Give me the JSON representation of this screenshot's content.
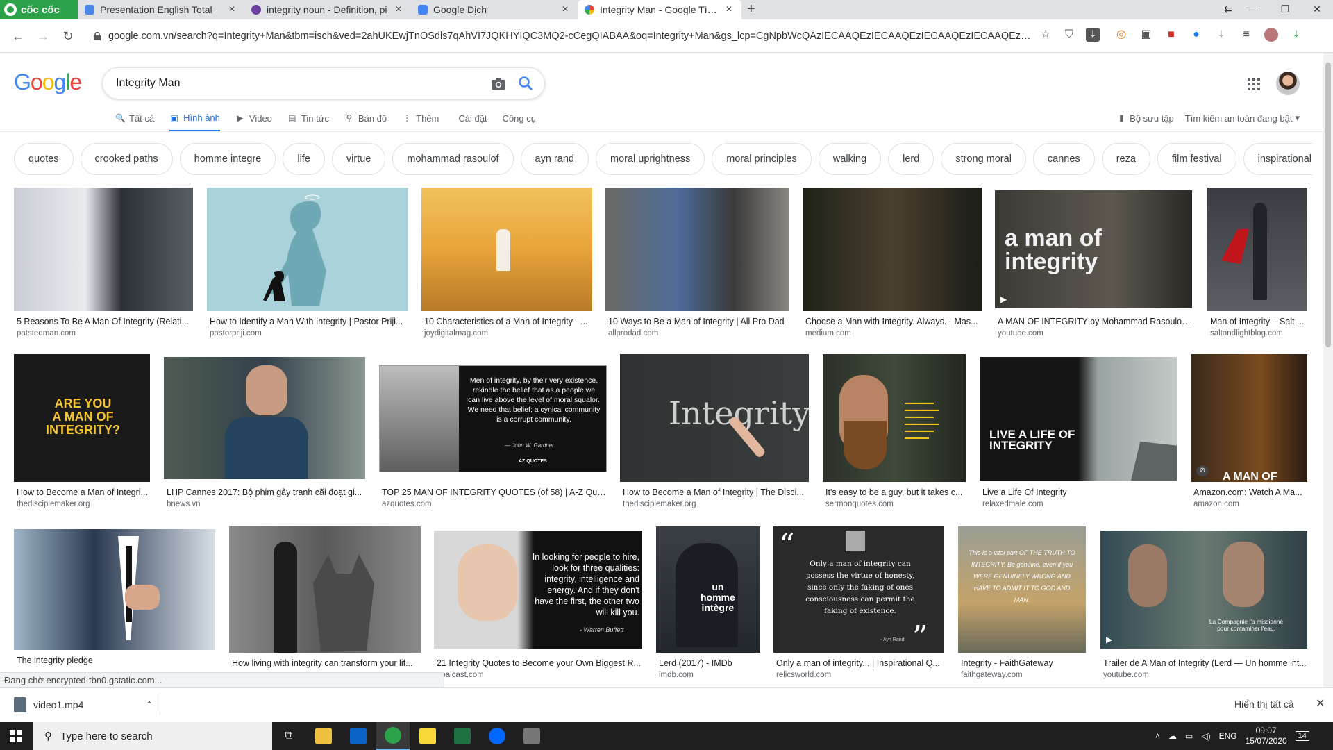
{
  "browser": {
    "brand": "cốc cốc",
    "tabs": [
      {
        "title": "Presentation English Total",
        "color": "#4a86e8"
      },
      {
        "title": "integrity noun - Definition, pi",
        "color": "#6a3fa0"
      },
      {
        "title": "Google Dịch",
        "color": "#4285f4"
      },
      {
        "title": "Integrity Man - Google Tìm ki",
        "color": "#ea4335"
      }
    ],
    "url": "google.com.vn/search?q=Integrity+Man&tbm=isch&ved=2ahUKEwjTnOSdls7qAhVI7JQKHYIQC3MQ2-cCegQIABAA&oq=Integrity+Man&gs_lcp=CgNpbWcQAzIECAAQEzIECAAQEzIECAAQEzIECAAQEzIECAAQBRAe..."
  },
  "google": {
    "logo": [
      "G",
      "o",
      "o",
      "g",
      "l",
      "e"
    ],
    "query": "Integrity Man",
    "menu": [
      {
        "label": "Tất cả",
        "icon": "🔍"
      },
      {
        "label": "Hình ảnh",
        "icon": "▣"
      },
      {
        "label": "Video",
        "icon": "▶"
      },
      {
        "label": "Tin tức",
        "icon": "▤"
      },
      {
        "label": "Bản đồ",
        "icon": "⚲"
      },
      {
        "label": "Thêm",
        "icon": "⋮"
      },
      {
        "label": "Cài đặt",
        "icon": ""
      },
      {
        "label": "Công cụ",
        "icon": ""
      }
    ],
    "collection": "Bộ sưu tập",
    "safesearch": "Tìm kiếm an toàn đang bật",
    "chips": [
      "quotes",
      "crooked paths",
      "homme integre",
      "life",
      "virtue",
      "mohammad rasoulof",
      "ayn rand",
      "moral uprightness",
      "moral principles",
      "walking",
      "lerd",
      "strong moral",
      "cannes",
      "reza",
      "film festival",
      "inspirational quotes"
    ]
  },
  "results": [
    {
      "caption": "5 Reasons To Be A Man Of Integrity (Relati...",
      "source": "patstedman.com",
      "bg": "linear-gradient(90deg,#c9ced4,#e8ebee 40%,#2b2f36 60%,#5a5f66)"
    },
    {
      "caption": "How to Identify a Man With Integrity | Pastor Priji...",
      "source": "pastorpriji.com",
      "bg": "#a9d2da"
    },
    {
      "caption": "10 Characteristics of a Man of Integrity - ...",
      "source": "joydigitalmag.com",
      "bg": "linear-gradient(180deg,#f2c25b,#e8a43a 50%,#b77a28)"
    },
    {
      "caption": "10 Ways to Be a Man of Integrity | All Pro Dad",
      "source": "allprodad.com",
      "bg": "linear-gradient(90deg,#6b6a66,#4b6b98 40%,#3a3a3a 70%,#8a8780)"
    },
    {
      "caption": "Choose a Man with Integrity. Always. - Mas...",
      "source": "medium.com",
      "bg": "linear-gradient(90deg,#1e2118,#4a4030 50%,#1b1d17)"
    },
    {
      "caption": "A MAN OF INTEGRITY by Mohammad Rasoulof (...",
      "source": "youtube.com",
      "bg": "linear-gradient(90deg,#3d3a35,#5c5850 60%,#2a2824)"
    },
    {
      "caption": "Man of Integrity – Salt ...",
      "source": "saltandlightblog.com",
      "bg": "linear-gradient(180deg,#3a3d42,#5b5e62)"
    },
    {
      "caption": "How to Become a Man of Integri...",
      "source": "thedisciplemaker.org",
      "bg": "#1a1a1a"
    },
    {
      "caption": "LHP Cannes 2017: Bộ phim gây tranh cãi đoạt gi...",
      "source": "bnews.vn",
      "bg": "linear-gradient(90deg,#4f5b52,#34414b 50%,#8a9690)"
    },
    {
      "caption": "TOP 25 MAN OF INTEGRITY QUOTES (of 58) | A-Z Quotes",
      "source": "azquotes.com",
      "bg": "#111"
    },
    {
      "caption": "How to Become a Man of Integrity | The Disci...",
      "source": "thedisciplemaker.org",
      "bg": "linear-gradient(90deg,#2f3233,#3a3d3e)"
    },
    {
      "caption": "It's easy to be a guy, but it takes c...",
      "source": "sermonquotes.com",
      "bg": "linear-gradient(90deg,#2b3028,#3f4a3a 50%,#22261f)"
    },
    {
      "caption": "Live a Life Of Integrity",
      "source": "relaxedmale.com",
      "bg": "linear-gradient(90deg,#151515 50%,#9aa3a3 60%,#c3c9c7)"
    },
    {
      "caption": "Amazon.com: Watch A Ma...",
      "source": "amazon.com",
      "bg": "linear-gradient(90deg,#3a2a1a,#7a4a1e 60%,#2a1c12)"
    },
    {
      "caption": "The integrity pledge",
      "source": "",
      "bg": "linear-gradient(90deg,#9fb5c7,#2b3a52 40%,#d8dfe6)"
    },
    {
      "caption": "How living with integrity can transform your lif...",
      "source": "",
      "bg": "linear-gradient(90deg,#8a8a8a,#5a5a5a 50%,#8a8a8a)"
    },
    {
      "caption": "21 Integrity Quotes to Become your Own Biggest R...",
      "source": "goalcast.com",
      "bg": "linear-gradient(90deg,#d8d8d8 40%,#111 48%)"
    },
    {
      "caption": "Lerd (2017) - IMDb",
      "source": "imdb.com",
      "bg": "linear-gradient(180deg,#3a3f44,#22272b)"
    },
    {
      "caption": "Only a man of integrity... | Inspirational Q...",
      "source": "relicsworld.com",
      "bg": "#2a2a2a"
    },
    {
      "caption": "Integrity - FaithGateway",
      "source": "faithgateway.com",
      "bg": "linear-gradient(180deg,#9a9e95,#c4a36a 60%,#6a6a5a)"
    },
    {
      "caption": "Trailer de A Man of Integrity (Lerd — Un homme int...",
      "source": "youtube.com",
      "bg": "linear-gradient(90deg,#324a52,#6a7a72 50%,#2e3e44)"
    }
  ],
  "thumb_text": {
    "r5": "a man of\nintegrity",
    "r7": "ARE YOU\nA MAN OF\nINTEGRITY?",
    "r9": "Men of integrity, by their very existence, rekindle the belief that as a people we can live above the level of moral squalor. We need that belief; a cynical community is a corrupt community.",
    "r9_author": "— John W. Gardner",
    "r9_brand": "AZ QUOTES",
    "r10": "Integrity",
    "r12": "LIVE A LIFE OF\nINTEGRITY",
    "r13": "A MAN OF",
    "r16": "In looking for people to hire, look for three qualities: integrity, intelligence and energy. And if they don't have the first, the other two will kill you.",
    "r16_author": "- Warren Buffett",
    "r17": "un\nhomme\nintègre",
    "r18": "Only a man of integrity can possess the virtue of honesty, since only the faking of ones consciousness can permit the faking of existence.",
    "r18_author": "- Ayn Rand",
    "r19": "This is a vital part OF THE TRUTH TO INTEGRITY. Be genuine, even if you WERE GENUINELY WRONG AND HAVE TO ADMIT IT TO GOD AND MAN.",
    "r20": "La Compagnie l'a missionné pour contaminer l'eau."
  },
  "status": "Đang chờ encrypted-tbn0.gstatic.com...",
  "download": {
    "file": "video1.mp4",
    "show_all": "Hiển thị tất cả"
  },
  "taskbar": {
    "search": "Type here to search",
    "lang": "ENG",
    "time": "09:07",
    "date": "15/07/2020",
    "notifications": "14"
  }
}
